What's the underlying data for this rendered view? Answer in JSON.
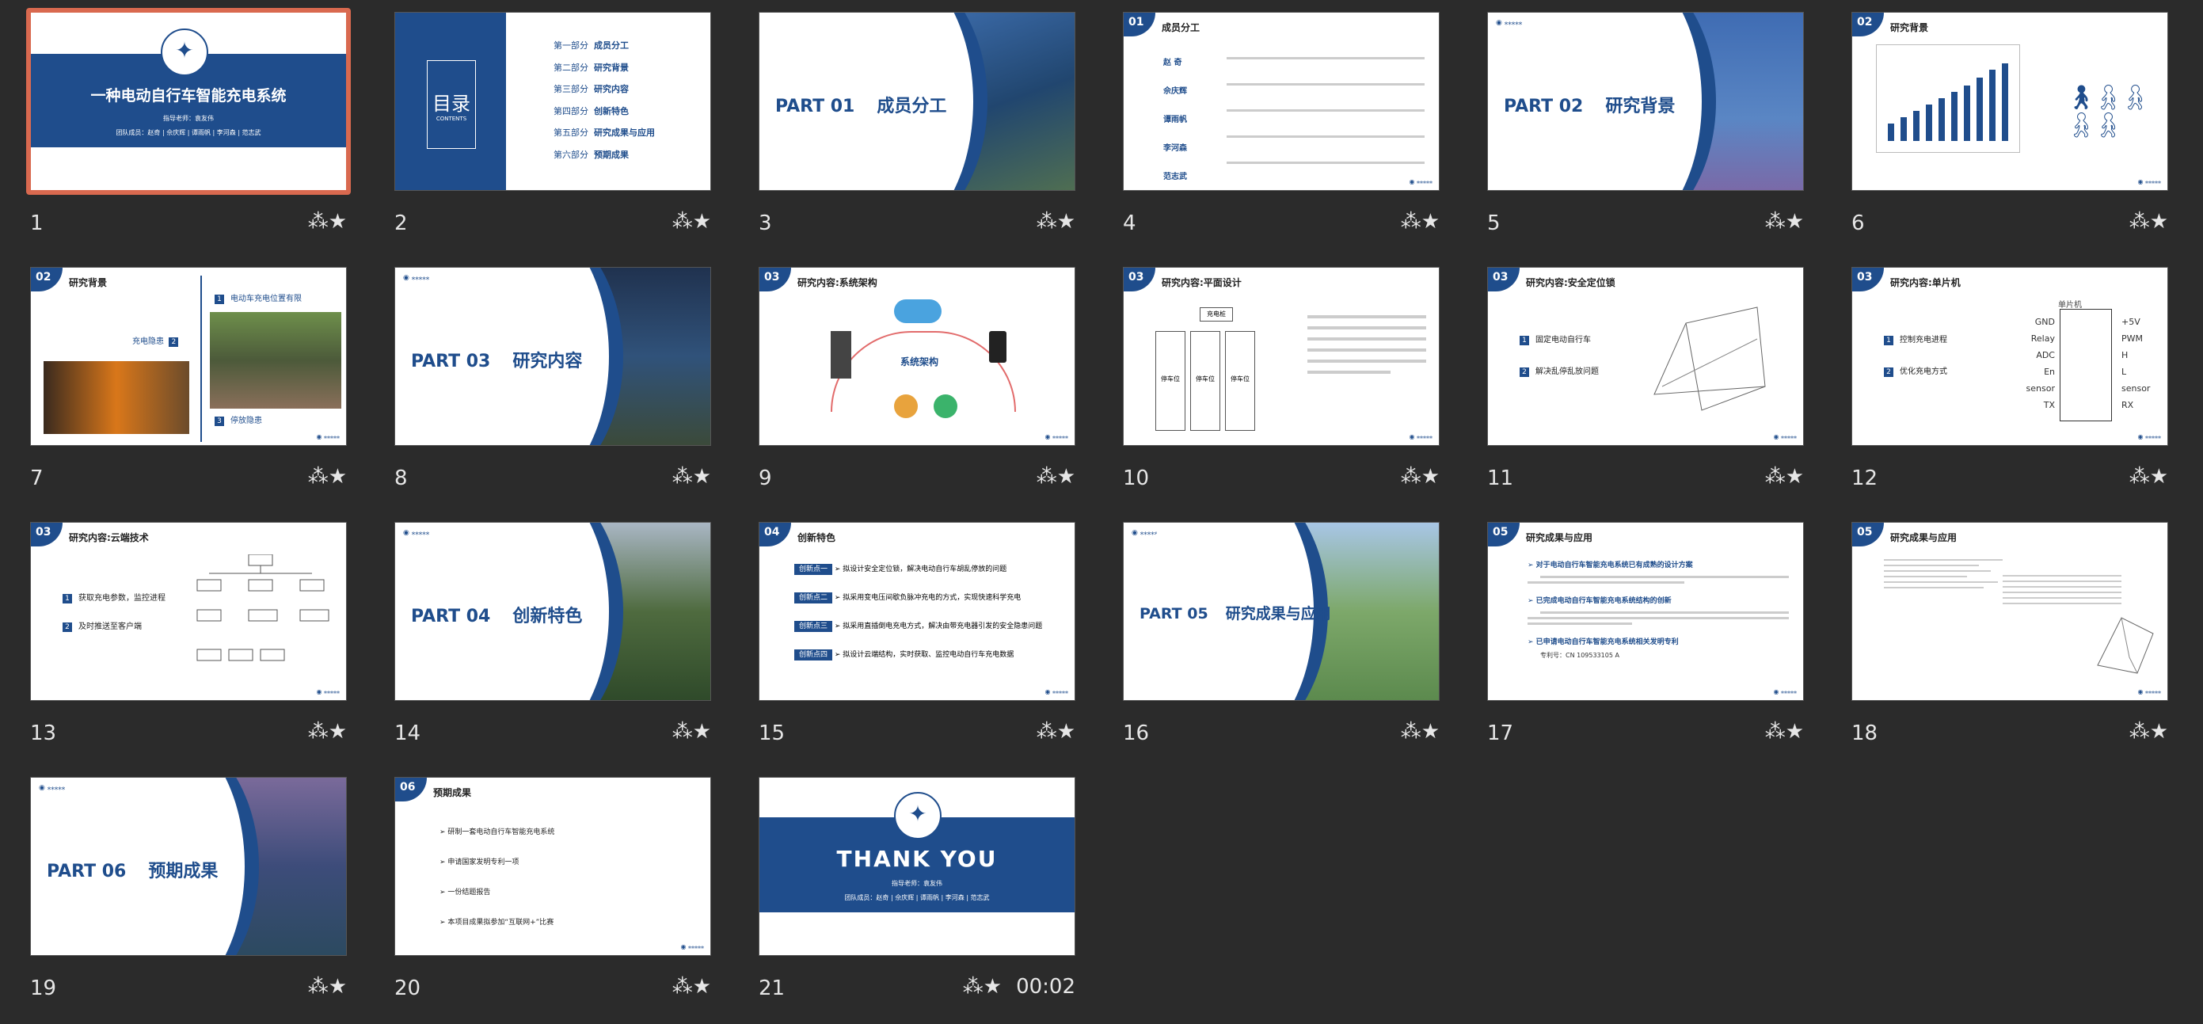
{
  "cells": [
    {
      "num": "1",
      "selected": true
    },
    {
      "num": "2"
    },
    {
      "num": "3"
    },
    {
      "num": "4"
    },
    {
      "num": "5"
    },
    {
      "num": "6"
    },
    {
      "num": "7"
    },
    {
      "num": "8"
    },
    {
      "num": "9"
    },
    {
      "num": "10"
    },
    {
      "num": "11"
    },
    {
      "num": "12"
    },
    {
      "num": "13"
    },
    {
      "num": "14"
    },
    {
      "num": "15"
    },
    {
      "num": "16"
    },
    {
      "num": "17"
    },
    {
      "num": "18"
    },
    {
      "num": "19"
    },
    {
      "num": "20"
    },
    {
      "num": "21",
      "time": "00:02"
    }
  ],
  "icons": {
    "transition": "transition-star-icon"
  },
  "colors": {
    "background": "#2b2b2b",
    "accent": "#1f4d8c",
    "selection": "#d9694f"
  },
  "s1": {
    "title": "一种电动自行车智能充电系统",
    "advisor": "指导老师：袁友伟",
    "team": "团队成员：赵奇 | 佘庆辉 | 谭雨帆 | 李河森 | 范志武"
  },
  "s2": {
    "toc": "目录",
    "toc_en": "CONTENTS",
    "items": [
      {
        "k": "第一部分",
        "v": "成员分工"
      },
      {
        "k": "第二部分",
        "v": "研究背景"
      },
      {
        "k": "第三部分",
        "v": "研究内容"
      },
      {
        "k": "第四部分",
        "v": "创新特色"
      },
      {
        "k": "第五部分",
        "v": "研究成果与应用"
      },
      {
        "k": "第六部分",
        "v": "预期成果"
      }
    ]
  },
  "s3": {
    "part": "PART 01",
    "name": "成员分工"
  },
  "s4": {
    "tag": "01",
    "title": "成员分工",
    "members": [
      "赵 奇",
      "佘庆辉",
      "谭雨帆",
      "李河森",
      "范志武"
    ]
  },
  "s5": {
    "part": "PART 02",
    "name": "研究背景"
  },
  "s6": {
    "tag": "02",
    "title": "研究背景"
  },
  "s7": {
    "tag": "02",
    "title": "研究背景",
    "p1": "电动车充电位置有限",
    "p2": "充电隐患",
    "p3": "停放隐患"
  },
  "s8": {
    "part": "PART 03",
    "name": "研究内容"
  },
  "s9": {
    "tag": "03",
    "title": "研究内容:系统架构",
    "center": "系统架构"
  },
  "s10": {
    "tag": "03",
    "title": "研究内容:平面设计",
    "caption": "充电桩",
    "slot": "停车位"
  },
  "s11": {
    "tag": "03",
    "title": "研究内容:安全定位锁",
    "b1": "固定电动自行车",
    "b2": "解决乱停乱放问题"
  },
  "s12": {
    "tag": "03",
    "title": "研究内容:单片机",
    "b1": "控制充电进程",
    "b2": "优化充电方式",
    "chip": "单片机",
    "left": [
      "GND",
      "Relay",
      "ADC",
      "En",
      "sensor",
      "TX"
    ],
    "right": [
      "+5V",
      "PWM",
      "H",
      "L",
      "sensor",
      "RX"
    ]
  },
  "s13": {
    "tag": "03",
    "title": "研究内容:云端技术",
    "b1": "获取充电参数，监控进程",
    "b2": "及时推送至客户端"
  },
  "s14": {
    "part": "PART 04",
    "name": "创新特色"
  },
  "s15": {
    "tag": "04",
    "title": "创新特色",
    "rows": [
      {
        "k": "创新点一",
        "v": "➢ 拟设计安全定位锁，解决电动自行车胡乱停放的问题"
      },
      {
        "k": "创新点二",
        "v": "➢ 拟采用变电压间歇负脉冲充电的方式，实现快速科学充电"
      },
      {
        "k": "创新点三",
        "v": "➢ 拟采用直插倒电充电方式，解决由带充电器引发的安全隐患问题"
      },
      {
        "k": "创新点四",
        "v": "➢ 拟设计云端结构，实时获取、监控电动自行车充电数据"
      }
    ]
  },
  "s16": {
    "part": "PART 05",
    "name": "研究成果与应用"
  },
  "s17": {
    "tag": "05",
    "title": "研究成果与应用",
    "h1": "➢ 对于电动自行车智能充电系统已有成熟的设计方案",
    "h2": "➢ 已完成电动自行车智能充电系统结构的创新",
    "h3": "➢ 已申请电动自行车智能充电系统相关发明专利",
    "patent": "专利号：CN 109533105 A"
  },
  "s18": {
    "tag": "05",
    "title": "研究成果与应用"
  },
  "s19": {
    "part": "PART 06",
    "name": "预期成果"
  },
  "s20": {
    "tag": "06",
    "title": "预期成果",
    "items": [
      "➢ 研制一套电动自行车智能充电系统",
      "➢ 申请国家发明专利一项",
      "➢ 一份结题报告",
      "➢ 本项目成果拟参加“互联网+”比赛"
    ]
  },
  "s21": {
    "title": "THANK YOU",
    "advisor": "指导老师：袁友伟",
    "team": "团队成员：赵奇 | 佘庆辉 | 谭雨帆 | 李河森 | 范志武"
  }
}
